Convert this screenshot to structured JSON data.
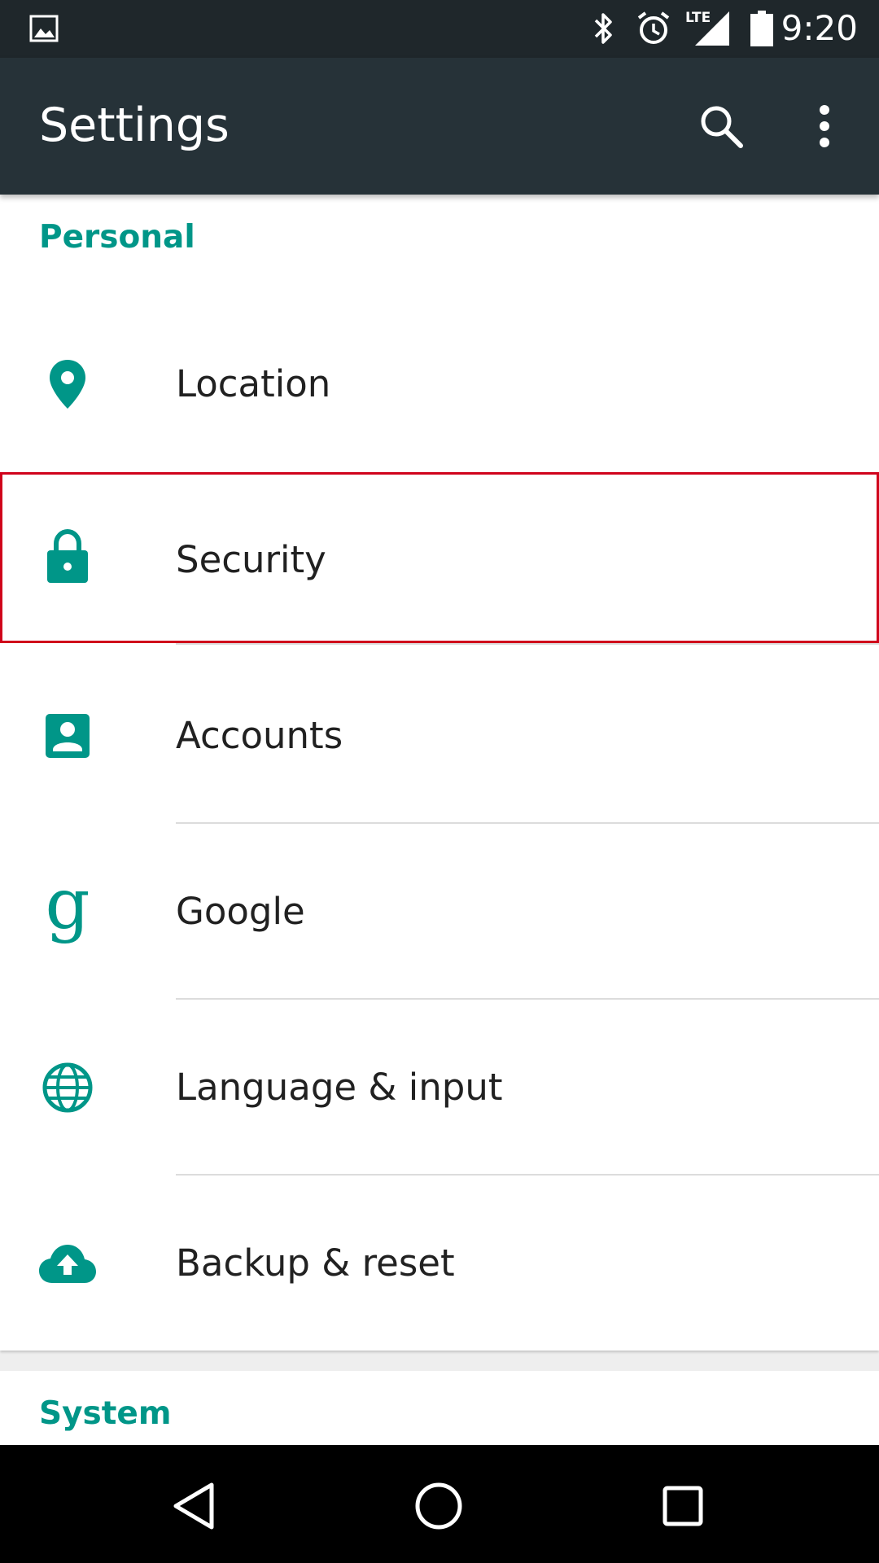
{
  "status_bar": {
    "time": "9:20",
    "lte_label": "LTE"
  },
  "app_bar": {
    "title": "Settings"
  },
  "sections": {
    "personal": {
      "header": "Personal",
      "items": [
        {
          "label": "Location",
          "icon": "location-pin-icon"
        },
        {
          "label": "Security",
          "icon": "lock-icon"
        },
        {
          "label": "Accounts",
          "icon": "account-box-icon"
        },
        {
          "label": "Google",
          "icon": "google-g-icon"
        },
        {
          "label": "Language & input",
          "icon": "globe-icon"
        },
        {
          "label": "Backup & reset",
          "icon": "cloud-upload-icon"
        }
      ]
    },
    "system": {
      "header": "System"
    }
  },
  "colors": {
    "accent": "#009688",
    "status_bar": "#1f272b",
    "app_bar": "#263238",
    "highlight": "#d0021b"
  }
}
